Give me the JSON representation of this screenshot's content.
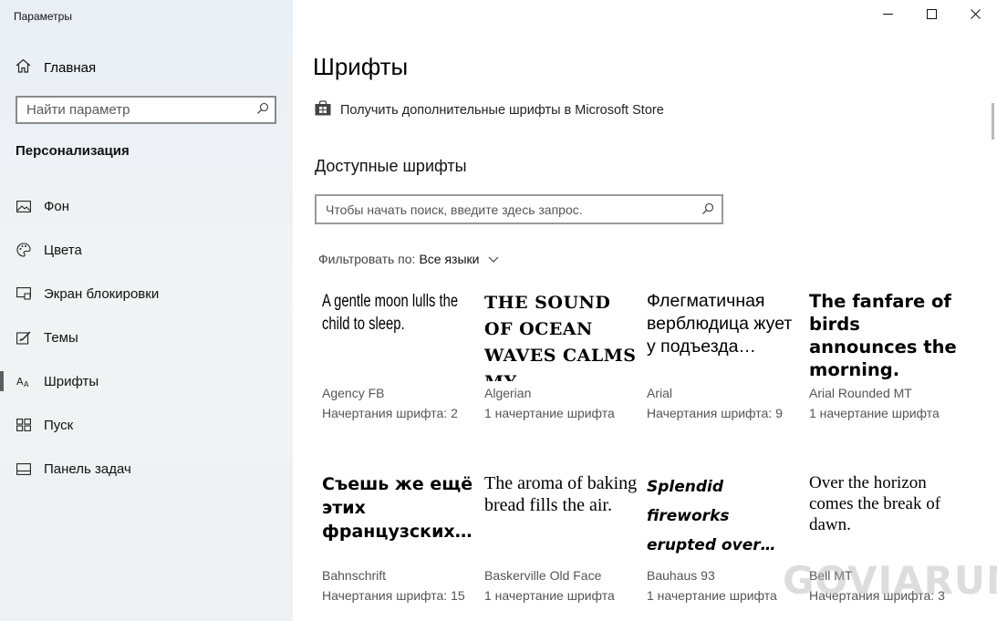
{
  "window": {
    "title": "Параметры"
  },
  "sidebar": {
    "home_label": "Главная",
    "search_placeholder": "Найти параметр",
    "section": "Персонализация",
    "items": [
      {
        "label": "Фон",
        "icon": "picture-icon"
      },
      {
        "label": "Цвета",
        "icon": "palette-icon"
      },
      {
        "label": "Экран блокировки",
        "icon": "lock-screen-icon"
      },
      {
        "label": "Темы",
        "icon": "themes-icon"
      },
      {
        "label": "Шрифты",
        "icon": "fonts-icon",
        "active": true
      },
      {
        "label": "Пуск",
        "icon": "start-icon"
      },
      {
        "label": "Панель задач",
        "icon": "taskbar-icon"
      }
    ]
  },
  "main": {
    "title": "Шрифты",
    "store_link": "Получить дополнительные шрифты в Microsoft Store",
    "available_heading": "Доступные шрифты",
    "search_placeholder": "Чтобы начать поиск, введите здесь запрос.",
    "filter_label": "Фильтровать по:",
    "filter_value": "Все языки",
    "fonts": [
      {
        "sample": "A gentle moon lulls the child to sleep.",
        "name": "Agency FB",
        "count": "Начертания шрифта: 2"
      },
      {
        "sample": "THE SOUND OF OCEAN WAVES CALMS MY…",
        "name": "Algerian",
        "count": "1 начертание шрифта"
      },
      {
        "sample": "Флегматичная верблюдица жует у подъезда…",
        "name": "Arial",
        "count": "Начертания шрифта: 9"
      },
      {
        "sample": "The fanfare of birds announces the morning.",
        "name": "Arial Rounded MT",
        "count": "1 начертание шрифта"
      },
      {
        "sample": "Съешь же ещё этих французских…",
        "name": "Bahnschrift",
        "count": "Начертания шрифта: 15"
      },
      {
        "sample": "The aroma of baking bread fills the air.",
        "name": "Baskerville Old Face",
        "count": "1 начертание шрифта"
      },
      {
        "sample": "Splendid fireworks erupted over…",
        "name": "Bauhaus 93",
        "count": "1 начертание шрифта"
      },
      {
        "sample": "Over the horizon comes the break of dawn.",
        "name": "Bell MT",
        "count": "Начертания шрифта: 3"
      }
    ]
  },
  "watermark": "GOVIARUM"
}
